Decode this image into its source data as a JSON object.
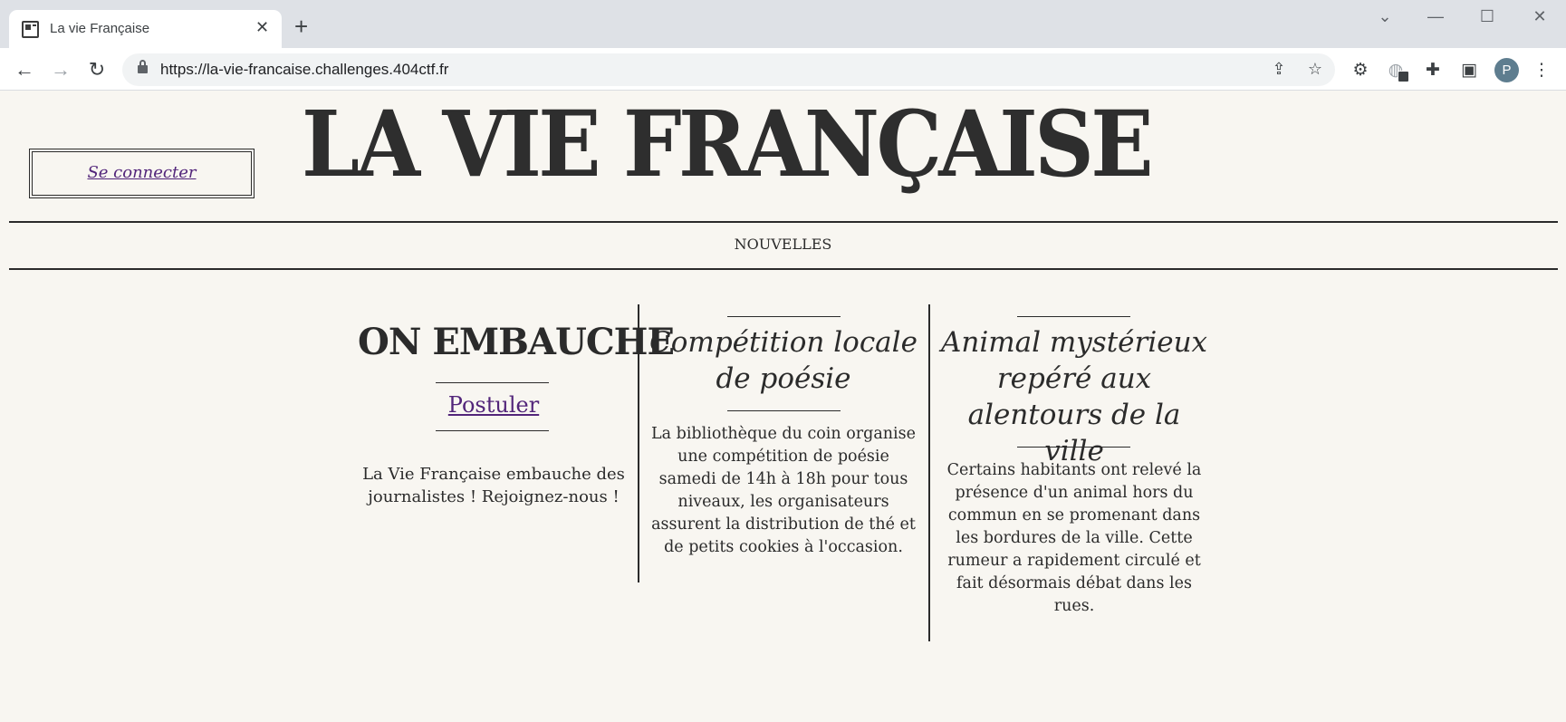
{
  "browser": {
    "tab_title": "La vie Française",
    "tab_close": "✕",
    "new_tab": "+",
    "url": "https://la-vie-francaise.challenges.404ctf.fr",
    "profile_initial": "P"
  },
  "site": {
    "masthead": "LA VIE FRANÇAISE",
    "login_label": "Se connecter",
    "nav_label": "NOUVELLES"
  },
  "articles": [
    {
      "title": "ON EMBAUCHE",
      "link_label": "Postuler",
      "body": "La Vie Française embauche des journalistes ! Rejoignez-nous !"
    },
    {
      "title": "Compétition locale de poésie",
      "body": "La bibliothèque du coin organise une compétition de poésie samedi de 14h à 18h pour tous niveaux, les organisateurs assurent la distribution de thé et de petits cookies à l'occasion."
    },
    {
      "title": "Animal mystérieux repéré aux alentours de la ville",
      "body": "Certains habitants ont relevé la présence d'un animal hors du commun en se promenant dans les bordures de la ville. Cette rumeur a rapidement circulé et fait désormais débat dans les rues."
    }
  ],
  "colors": {
    "page_background": "#f8f6f1",
    "text": "#2b2b2b",
    "link_visited": "#52257a"
  },
  "icons": [
    "newspaper-favicon-icon",
    "lock-icon",
    "share-icon",
    "star-icon",
    "extension-icon",
    "puzzle-icon",
    "side-panel-icon",
    "menu-icon"
  ]
}
